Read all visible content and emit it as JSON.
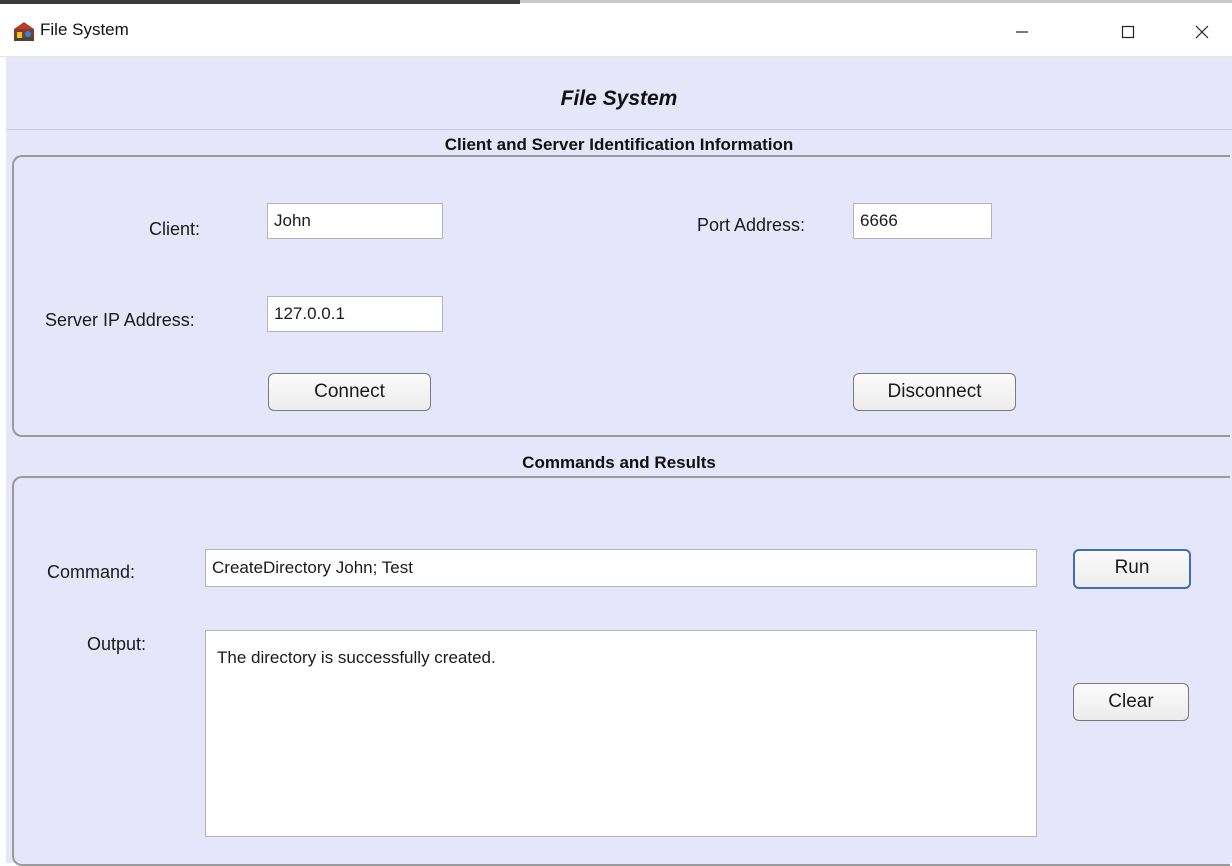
{
  "window": {
    "title": "File System",
    "minimize_label": "Minimize",
    "maximize_label": "Maximize",
    "close_label": "Close"
  },
  "header": {
    "title": "File System"
  },
  "identification": {
    "section_title": "Client and Server Identification Information",
    "client_label": "Client:",
    "client_value": "John",
    "port_label": "Port Address:",
    "port_value": "6666",
    "server_ip_label": "Server IP Address:",
    "server_ip_value": "127.0.0.1",
    "connect_label": "Connect",
    "disconnect_label": "Disconnect"
  },
  "commands": {
    "section_title": "Commands and Results",
    "command_label": "Command:",
    "command_value": "CreateDirectory John; Test",
    "run_label": "Run",
    "output_label": "Output:",
    "output_value": "The directory is successfully created.",
    "clear_label": "Clear"
  },
  "icons": {
    "app": "app-icon",
    "minimize": "minimize-icon",
    "maximize": "maximize-icon",
    "close": "close-icon"
  },
  "colors": {
    "client_background": "#e6e6fa",
    "focus_border": "#3d6fb6",
    "panel_border": "#9a9a9a"
  }
}
